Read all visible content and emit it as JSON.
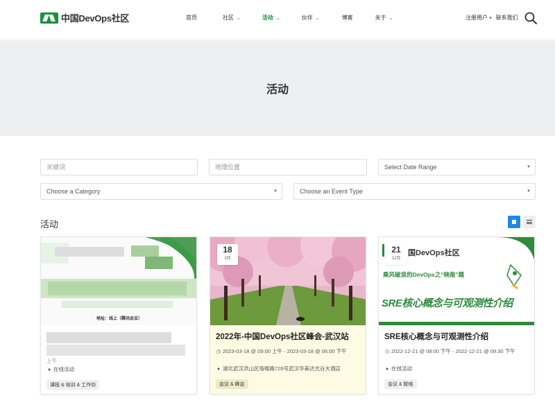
{
  "header": {
    "logo_text": "中国DevOps社区",
    "nav": [
      {
        "label": "首页",
        "dropdown": false,
        "active": false
      },
      {
        "label": "社区",
        "dropdown": true,
        "active": false
      },
      {
        "label": "活动",
        "dropdown": true,
        "active": true
      },
      {
        "label": "伙伴",
        "dropdown": true,
        "active": false
      },
      {
        "label": "博客",
        "dropdown": false,
        "active": false
      },
      {
        "label": "关于",
        "dropdown": true,
        "active": false
      }
    ],
    "register": "注册用户",
    "register_arrow": "▾",
    "contact": "联系我们"
  },
  "hero": {
    "title": "活动"
  },
  "filters": {
    "keyword_placeholder": "关键词",
    "location_placeholder": "地理位置",
    "date_range": "Select Date Range",
    "category": "Choose a Category",
    "event_type": "Choose an Event Type"
  },
  "section": {
    "title": "活动"
  },
  "cards": [
    {
      "blurred": true,
      "image_caption": "地址：线上（腾讯会议）",
      "meta_partial": "上午",
      "location": "在线活动",
      "tags": "课程 & 培训 & 工作坊"
    },
    {
      "day": "18",
      "month": "3月",
      "title": "2022年-中国DevOps社区峰会-武汉站",
      "time": "2023-03-18 @ 09:00 上午 - 2023-03-18 @ 06:00 下午",
      "location": "湖北武汉洪山区珞喻路726号武汉华美达光谷大酒店",
      "tags": "会议 & 峰会"
    },
    {
      "day": "21",
      "month": "12月",
      "banner_logo": "国DevOps社区",
      "banner_subtitle": "乘风破浪的DevOps之“晓南”题",
      "banner_title": "SRE核心概念与可观测性介绍",
      "title": "SRE核心概念与可观测性介绍",
      "time": "2022-12-21 @ 08:00 下午 - 2022-12-21 @ 09:30 下午",
      "location": "在线活动",
      "tags": "会议 & 联络"
    }
  ],
  "colors": {
    "brand_green": "#1b8f3a",
    "accent_blue": "#1e88e5",
    "hero_bg": "#eeeff1",
    "featured_bg": "#fdfbe3"
  },
  "icons": [
    "clock-icon",
    "map-pin-icon",
    "search-icon",
    "grid-view-icon",
    "list-view-icon"
  ]
}
